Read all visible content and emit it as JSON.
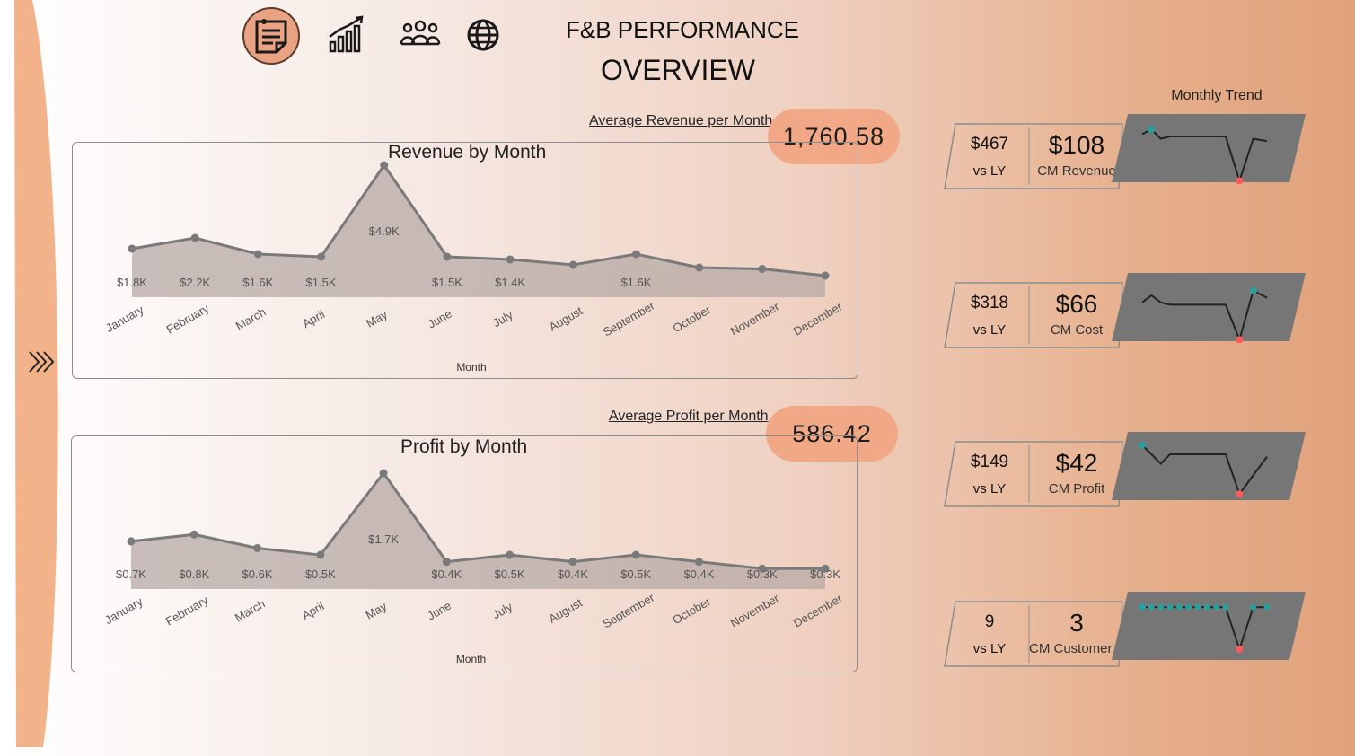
{
  "nav": {
    "icons": [
      "notes-icon",
      "growth-chart-icon",
      "people-icon",
      "globe-icon"
    ],
    "active_index": 0
  },
  "title": {
    "line1": "F&B PERFORMANCE",
    "line2": "OVERVIEW"
  },
  "revenue": {
    "avg_label": "Average Revenue per Month",
    "avg_value": "1,760.58"
  },
  "profit": {
    "avg_label": "Average Profit per Month",
    "avg_value": "586.42"
  },
  "chart_data": [
    {
      "type": "area",
      "title": "Revenue by Month",
      "xlabel": "Month",
      "ylabel": "",
      "categories": [
        "January",
        "February",
        "March",
        "April",
        "May",
        "June",
        "July",
        "August",
        "September",
        "October",
        "November",
        "December"
      ],
      "values": [
        1.8,
        2.2,
        1.6,
        1.5,
        4.9,
        1.5,
        1.4,
        1.2,
        1.6,
        1.1,
        1.05,
        0.8
      ],
      "data_labels": [
        "$1.8K",
        "$2.2K",
        "$1.6K",
        "$1.5K",
        "$4.9K",
        "$1.5K",
        "$1.4K",
        "",
        "$1.6K",
        "",
        "",
        ""
      ],
      "unit": "K"
    },
    {
      "type": "area",
      "title": "Profit by Month",
      "xlabel": "Month",
      "ylabel": "",
      "categories": [
        "January",
        "February",
        "March",
        "April",
        "May",
        "June",
        "July",
        "August",
        "September",
        "October",
        "November",
        "December"
      ],
      "values": [
        0.7,
        0.8,
        0.6,
        0.5,
        1.7,
        0.4,
        0.5,
        0.4,
        0.5,
        0.4,
        0.3,
        0.3
      ],
      "data_labels": [
        "$0.7K",
        "$0.8K",
        "$0.6K",
        "$0.5K",
        "$1.7K",
        "$0.4K",
        "$0.5K",
        "$0.4K",
        "$0.5K",
        "$0.4K",
        "$0.3K",
        "$0.3K"
      ],
      "unit": "K"
    }
  ],
  "trend_title": "Monthly Trend",
  "kpis": [
    {
      "ly_value": "$467",
      "ly_label": "vs LY",
      "cm_value": "$108",
      "cm_label": "CM Revenue",
      "spark": [
        0.8,
        0.9,
        0.7,
        0.75,
        0.75,
        0.75,
        0.75,
        0.75,
        0.75,
        0.75,
        -0.2,
        0.7,
        0.65
      ],
      "spark_max_idx": 1,
      "spark_min_idx": 10
    },
    {
      "ly_value": "$318",
      "ly_label": "vs LY",
      "cm_value": "$66",
      "cm_label": "CM Cost",
      "spark": [
        0.6,
        0.75,
        0.6,
        0.55,
        0.55,
        0.55,
        0.55,
        0.55,
        0.55,
        0.55,
        -0.2,
        0.85,
        0.7
      ],
      "spark_max_idx": 11,
      "spark_min_idx": 10
    },
    {
      "ly_value": "$149",
      "ly_label": "vs LY",
      "cm_value": "$42",
      "cm_label": "CM Profit",
      "spark": [
        0.95,
        0.75,
        0.55,
        0.75,
        0.75,
        0.75,
        0.75,
        0.75,
        0.75,
        0.75,
        -0.1,
        0.3,
        0.7
      ],
      "spark_max_idx": 0,
      "spark_min_idx": 10
    },
    {
      "ly_value": "9",
      "ly_label": "vs LY",
      "cm_value": "3",
      "cm_label": "CM Customer Count",
      "spark": [
        0.9,
        0.9,
        0.9,
        0.9,
        0.9,
        0.9,
        0.9,
        0.9,
        0.9,
        0.9,
        0.0,
        0.9,
        0.9
      ],
      "spark_max_idx": 0,
      "spark_min_idx": 10
    }
  ],
  "colors": {
    "rail": "#f2b28a",
    "area_fill": "#b7aaa5",
    "line": "#7a7a7a",
    "pill": "#f0a886",
    "spark_bg": "#767676",
    "spark_line": "#222222",
    "spark_max": "#2a9d9d",
    "spark_min": "#ff5a5a"
  }
}
